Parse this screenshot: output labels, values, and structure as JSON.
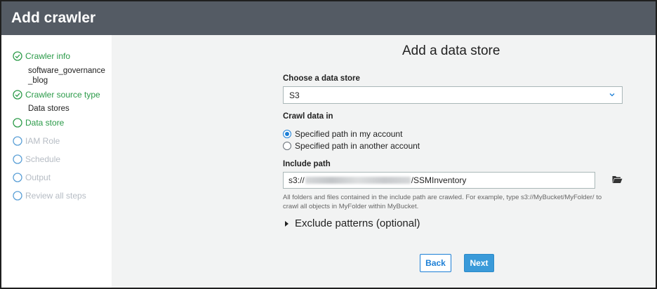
{
  "header": {
    "title": "Add crawler"
  },
  "sidebar": {
    "steps": [
      {
        "label": "Crawler info",
        "state": "done",
        "sub": "software_governance\n_blog"
      },
      {
        "label": "Crawler source type",
        "state": "done",
        "sub": "Data stores"
      },
      {
        "label": "Data store",
        "state": "active"
      },
      {
        "label": "IAM Role",
        "state": "todo"
      },
      {
        "label": "Schedule",
        "state": "todo"
      },
      {
        "label": "Output",
        "state": "todo"
      },
      {
        "label": "Review all steps",
        "state": "todo"
      }
    ]
  },
  "main": {
    "title": "Add a data store",
    "data_store_label": "Choose a data store",
    "data_store_value": "S3",
    "crawl_label": "Crawl data in",
    "crawl_options": [
      {
        "label": "Specified path in my account",
        "selected": true
      },
      {
        "label": "Specified path in another account",
        "selected": false
      }
    ],
    "include_label": "Include path",
    "include_prefix": "s3://",
    "include_suffix": "/SSMInventory",
    "help_line1": "All folders and files contained in the include path are crawled. For example, type s3://MyBucket/MyFolder/ to",
    "help_line2": "crawl all objects in MyFolder within MyBucket.",
    "exclude_label": "Exclude patterns (optional)",
    "back_label": "Back",
    "next_label": "Next"
  },
  "colors": {
    "header_bg": "#545b64",
    "step_done": "#2a9a48",
    "step_todo": "#b6bcc4",
    "primary_button": "#3a9ad9",
    "link_blue": "#1c7fd6"
  },
  "icons": {
    "step_done": "check-circle-icon",
    "step_pending": "circle-icon",
    "select": "chevron-down-icon",
    "browse": "folder-open-icon",
    "exclude": "caret-right-icon"
  }
}
